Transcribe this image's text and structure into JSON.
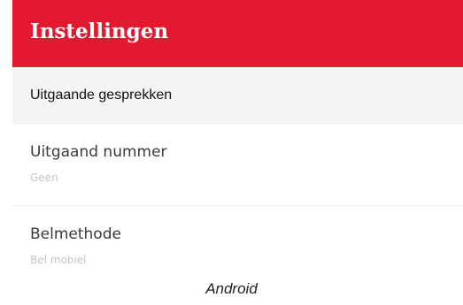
{
  "app_bar": {
    "title": "Instellingen",
    "color": "#e3192f"
  },
  "section": {
    "title": "Uitgaande gesprekken"
  },
  "settings": [
    {
      "title": "Uitgaand nummer",
      "value": "Geen"
    },
    {
      "title": "Belmethode",
      "value": "Bel mobiel"
    }
  ],
  "caption": "Android"
}
